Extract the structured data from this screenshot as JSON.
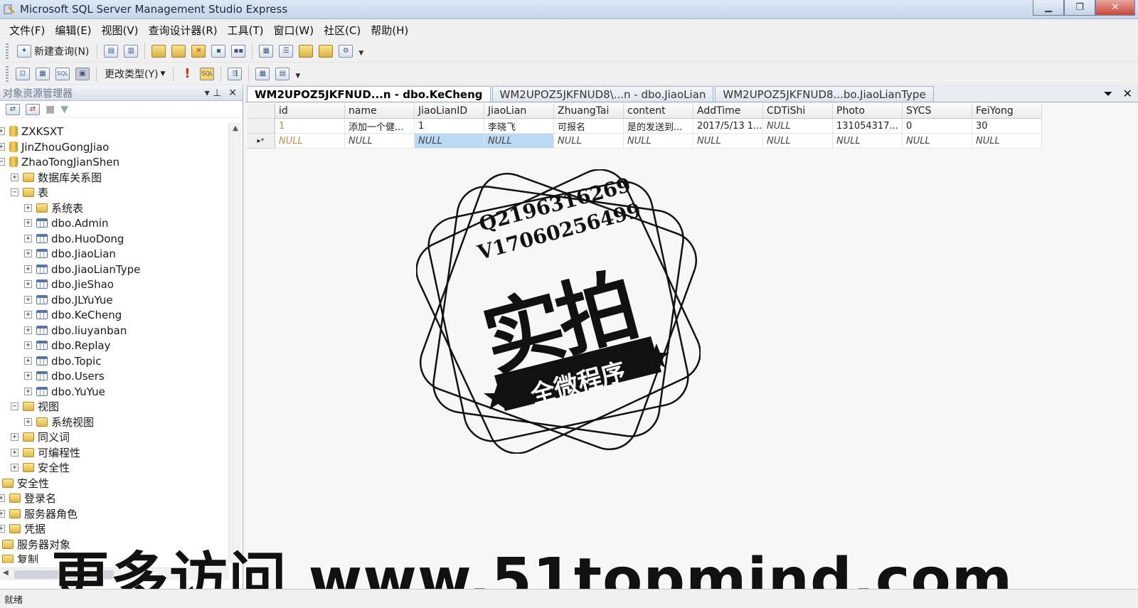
{
  "window": {
    "title": "Microsoft SQL Server Management Studio Express",
    "min": "▁",
    "max": "❐",
    "close": "✕"
  },
  "menu": [
    "文件(F)",
    "编辑(E)",
    "视图(V)",
    "查询设计器(R)",
    "工具(T)",
    "窗口(W)",
    "社区(C)",
    "帮助(H)"
  ],
  "toolbar1": {
    "new_query": "新建查询(N)"
  },
  "toolbar2": {
    "change_type": "更改类型(Y)"
  },
  "object_explorer": {
    "title": "对象资源管理器",
    "pin": "▾ ⊥",
    "close": "✕",
    "tree": [
      {
        "label": "ZXKSXT",
        "icon": "db-icon"
      },
      {
        "label": "JinZhouGongJiao",
        "icon": "db-icon"
      },
      {
        "label": "ZhaoTongJianShen",
        "icon": "db-icon"
      },
      {
        "label": "数据库关系图",
        "icon": "folder-icon"
      },
      {
        "label": "表",
        "icon": "folder-icon"
      },
      {
        "label": "系统表",
        "icon": "folder-icon"
      },
      {
        "label": "dbo.Admin",
        "icon": "table-icon"
      },
      {
        "label": "dbo.HuoDong",
        "icon": "table-icon"
      },
      {
        "label": "dbo.JiaoLian",
        "icon": "table-icon"
      },
      {
        "label": "dbo.JiaoLianType",
        "icon": "table-icon"
      },
      {
        "label": "dbo.JieShao",
        "icon": "table-icon"
      },
      {
        "label": "dbo.JLYuYue",
        "icon": "table-icon"
      },
      {
        "label": "dbo.KeCheng",
        "icon": "table-icon"
      },
      {
        "label": "dbo.liuyanban",
        "icon": "table-icon"
      },
      {
        "label": "dbo.Replay",
        "icon": "table-icon"
      },
      {
        "label": "dbo.Topic",
        "icon": "table-icon"
      },
      {
        "label": "dbo.Users",
        "icon": "table-icon"
      },
      {
        "label": "dbo.YuYue",
        "icon": "table-icon"
      },
      {
        "label": "视图",
        "icon": "folder-icon"
      },
      {
        "label": "系统视图",
        "icon": "folder-icon"
      },
      {
        "label": "同义词",
        "icon": "folder-icon"
      },
      {
        "label": "可编程性",
        "icon": "folder-icon"
      },
      {
        "label": "安全性",
        "icon": "folder-icon"
      },
      {
        "label": "安全性",
        "icon": "folder-icon"
      },
      {
        "label": "登录名",
        "icon": "folder-icon"
      },
      {
        "label": "服务器角色",
        "icon": "folder-icon"
      },
      {
        "label": "凭据",
        "icon": "folder-icon"
      },
      {
        "label": "服务器对象",
        "icon": "folder-icon"
      },
      {
        "label": "复制",
        "icon": "folder-icon"
      }
    ]
  },
  "tabs": [
    {
      "label": "WM2UPOZ5JKFNUD...n - dbo.KeCheng",
      "active": true
    },
    {
      "label": "WM2UPOZ5JKFNUD8\\...n - dbo.JiaoLian",
      "active": false
    },
    {
      "label": "WM2UPOZ5JKFNUD8...bo.JiaoLianType",
      "active": false
    }
  ],
  "grid": {
    "columns": [
      "id",
      "name",
      "JiaoLianID",
      "JiaoLian",
      "ZhuangTai",
      "content",
      "AddTime",
      "CDTiShi",
      "Photo",
      "SYCS",
      "FeiYong"
    ],
    "rows": [
      [
        "1",
        "添加一个健...",
        "1",
        "李晓飞",
        "可报名",
        "是的发送到...",
        "2017/5/13 1...",
        "NULL",
        "131054317...",
        "0",
        "30"
      ],
      [
        "NULL",
        "NULL",
        "NULL",
        "NULL",
        "NULL",
        "NULL",
        "NULL",
        "NULL",
        "NULL",
        "NULL",
        "NULL"
      ]
    ],
    "new_row_marker": "▸*"
  },
  "stamp": {
    "line1": "Q2196316269",
    "line2": "V17060256499",
    "main": "实拍",
    "ribbon": "全微程序"
  },
  "watermark_url": "更多访问 www.51topmind.com",
  "status": "就绪"
}
